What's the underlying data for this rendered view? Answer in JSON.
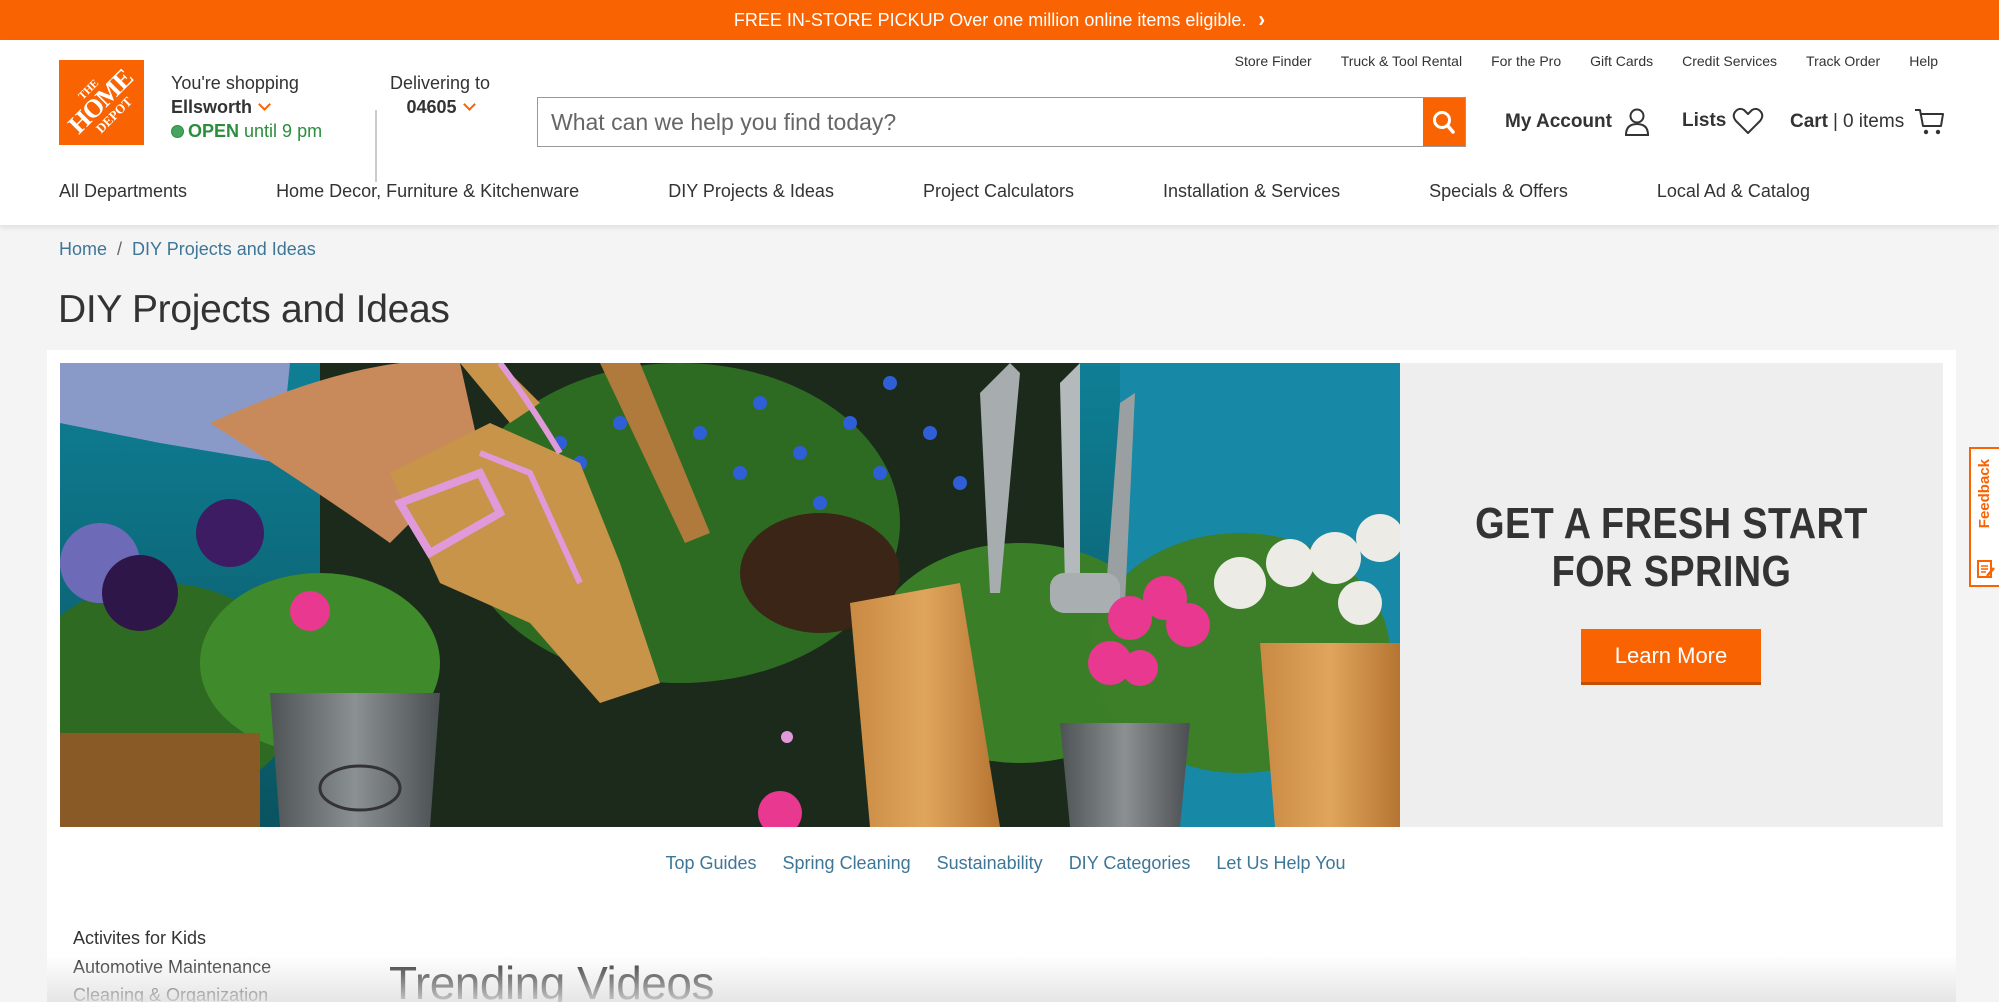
{
  "promo_bar": {
    "text": "FREE IN-STORE PICKUP Over one million online items eligible.",
    "chevron_icon": "chevron-right-icon"
  },
  "header": {
    "logo": {
      "line1": "THE",
      "line2": "HOME",
      "line3": "DEPOT"
    },
    "store": {
      "label": "You're shopping",
      "name": "Ellsworth",
      "status": "OPEN",
      "hours": "until 9 pm"
    },
    "delivery": {
      "label": "Delivering to",
      "zip": "04605"
    },
    "utility_links": [
      "Store Finder",
      "Truck & Tool Rental",
      "For the Pro",
      "Gift Cards",
      "Credit Services",
      "Track Order",
      "Help"
    ],
    "search": {
      "placeholder": "What can we help you find today?",
      "value": ""
    },
    "account": {
      "label": "My Account",
      "icon": "user-icon"
    },
    "lists": {
      "label": "Lists",
      "icon": "heart-icon"
    },
    "cart": {
      "label": "Cart",
      "count_text": "0 items",
      "icon": "cart-icon"
    }
  },
  "nav": {
    "items": [
      "All Departments",
      "Home Decor, Furniture & Kitchenware",
      "DIY Projects & Ideas",
      "Project Calculators",
      "Installation & Services",
      "Specials & Offers",
      "Local Ad & Catalog"
    ]
  },
  "breadcrumb": {
    "items": [
      "Home",
      "DIY Projects and Ideas"
    ],
    "separator": "/"
  },
  "page_title": "DIY Projects and Ideas",
  "hero": {
    "image_alt": "Gloved hand gardening with potted flowers and garden tools",
    "headline_line1": "GET A FRESH START",
    "headline_line2": "FOR SPRING",
    "cta_label": "Learn More"
  },
  "sub_nav": {
    "items": [
      "Top Guides",
      "Spring Cleaning",
      "Sustainability",
      "DIY Categories",
      "Let Us Help You"
    ]
  },
  "category_list": {
    "items": [
      "Activites for Kids",
      "Automotive Maintenance",
      "Cleaning & Organization"
    ]
  },
  "section_title": "Trending Videos",
  "feedback_tab": {
    "label": "Feedback"
  },
  "colors": {
    "brand_orange": "#f96302",
    "link_blue": "#3e7697",
    "open_green": "#2a8e3d"
  }
}
